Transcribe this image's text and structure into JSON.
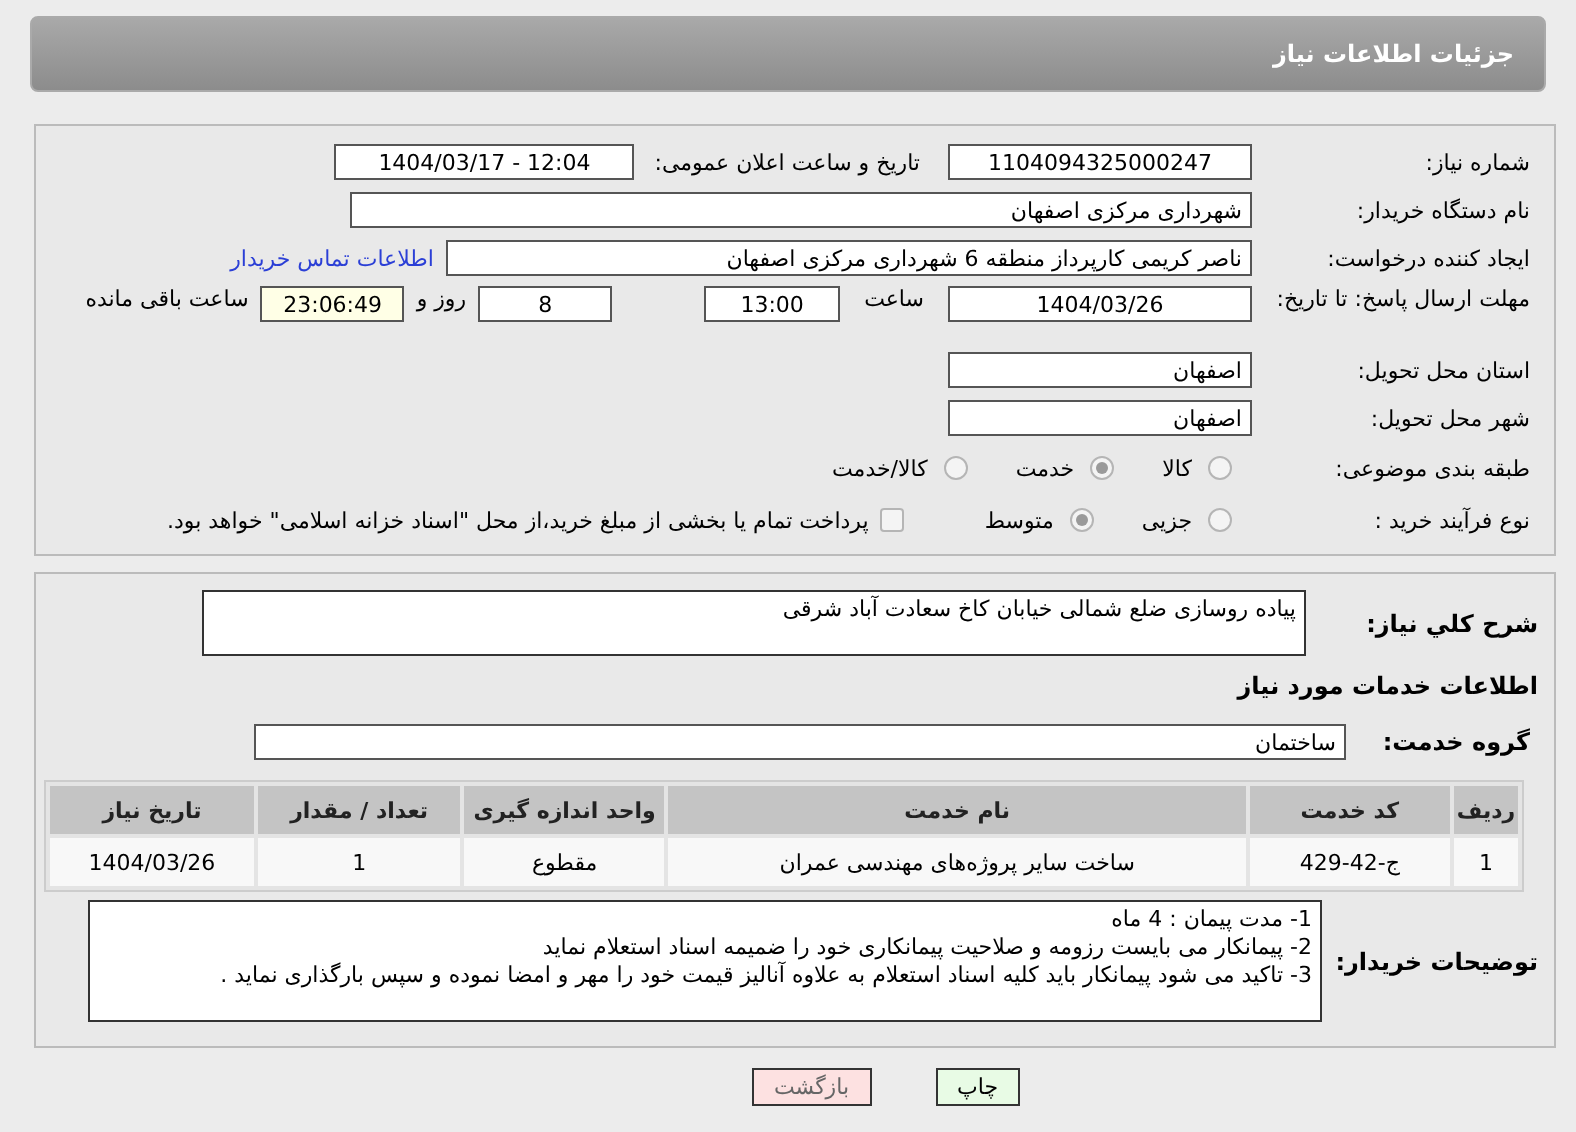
{
  "header": {
    "title": "جزئیات اطلاعات نیاز"
  },
  "need_number": {
    "label": "شماره نیاز:",
    "value": "1104094325000247"
  },
  "announce_datetime": {
    "label": "تاریخ و ساعت اعلان عمومی:",
    "value": "1404/03/17 - 12:04"
  },
  "buyer_org": {
    "label": "نام دستگاه خریدار:",
    "value": "شهرداری مرکزی اصفهان"
  },
  "requester": {
    "label": "ایجاد کننده درخواست:",
    "value": "ناصر کریمی کارپرداز منطقه 6 شهرداری مرکزی اصفهان",
    "link": "اطلاعات تماس خریدار"
  },
  "deadline": {
    "label": "مهلت ارسال پاسخ: تا تاریخ:",
    "date": "1404/03/26",
    "time_label": "ساعت",
    "time": "13:00",
    "days": "8",
    "days_label": "روز و",
    "remaining": "23:06:49",
    "remaining_label": "ساعت باقی مانده"
  },
  "province": {
    "label": "استان محل تحویل:",
    "value": "اصفهان"
  },
  "city": {
    "label": "شهر محل تحویل:",
    "value": "اصفهان"
  },
  "category": {
    "label": "طبقه بندی موضوعی:",
    "options": [
      {
        "label": "کالا",
        "selected": false
      },
      {
        "label": "خدمت",
        "selected": true
      },
      {
        "label": "کالا/خدمت",
        "selected": false
      }
    ]
  },
  "process": {
    "label": "نوع فرآیند خرید :",
    "options": [
      {
        "label": "جزیی",
        "selected": false
      },
      {
        "label": "متوسط",
        "selected": true
      }
    ],
    "payment": {
      "label": "پرداخت تمام یا بخشی از مبلغ خرید،از محل \"اسناد خزانه اسلامی\" خواهد بود.",
      "checked": false
    }
  },
  "description": {
    "label": "شرح کلي نیاز:",
    "value": "پیاده روسازی ضلع شمالی خیابان کاخ سعادت آباد شرقی"
  },
  "services_heading": "اطلاعات خدمات مورد نیاز",
  "service_group": {
    "label": "گروه خدمت:",
    "value": "ساختمان"
  },
  "table": {
    "columns": [
      "ردیف",
      "کد خدمت",
      "نام خدمت",
      "واحد اندازه گیری",
      "تعداد / مقدار",
      "تاریخ نیاز"
    ],
    "rows": [
      [
        "1",
        "ج-42-429",
        "ساخت سایر پروژه‌های مهندسی عمران",
        "مقطوع",
        "1",
        "1404/03/26"
      ]
    ]
  },
  "buyer_notes": {
    "label": "توضیحات خریدار:",
    "lines": [
      "1- مدت پیمان : 4 ماه",
      "2- پیمانکار می بایست رزومه و صلاحیت پیمانکاری خود را ضمیمه اسناد استعلام نماید",
      "3- تاکید می شود پیمانکار باید کلیه اسناد استعلام به علاوه آنالیز قیمت خود را مهر و امضا نموده و سپس بارگذاری نماید ."
    ]
  },
  "buttons": [
    {
      "label": "چاپ",
      "kind": "print"
    },
    {
      "label": "بازگشت",
      "kind": "back"
    }
  ]
}
